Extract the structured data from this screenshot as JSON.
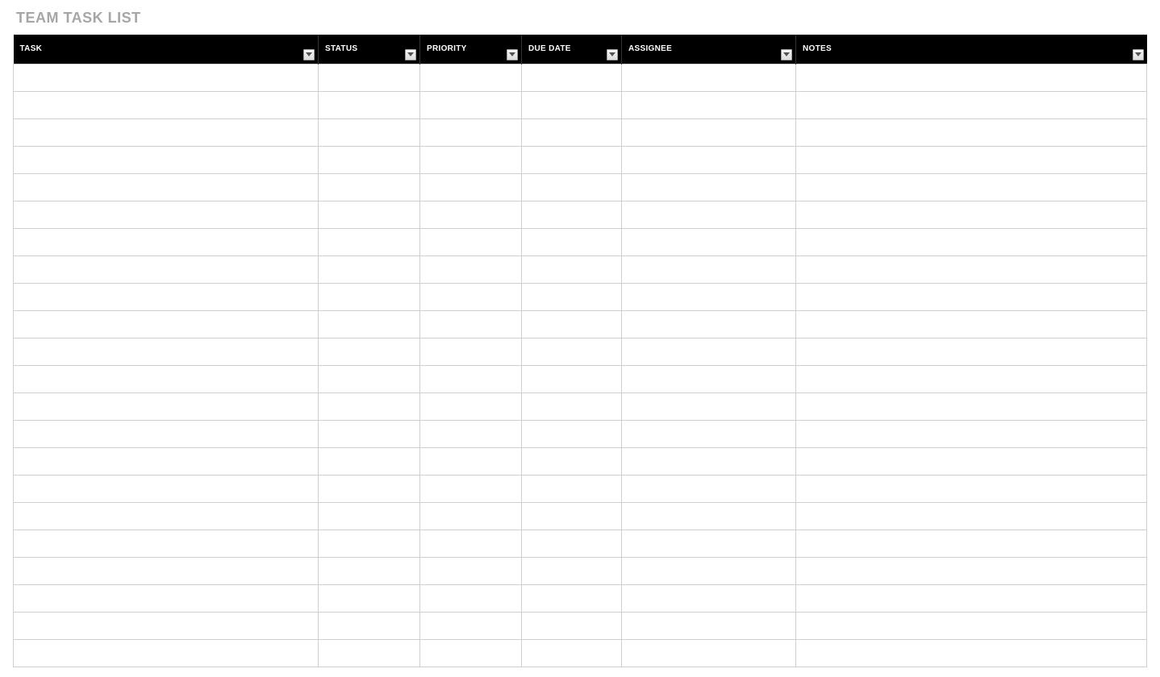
{
  "title": "TEAM TASK LIST",
  "columns": [
    {
      "label": "TASK",
      "key": "task"
    },
    {
      "label": "STATUS",
      "key": "status"
    },
    {
      "label": "PRIORITY",
      "key": "priority"
    },
    {
      "label": "DUE DATE",
      "key": "duedate"
    },
    {
      "label": "ASSIGNEE",
      "key": "assignee"
    },
    {
      "label": "NOTES",
      "key": "notes"
    }
  ],
  "rows": [
    {
      "task": "",
      "status": "",
      "priority": "",
      "duedate": "",
      "assignee": "",
      "notes": ""
    },
    {
      "task": "",
      "status": "",
      "priority": "",
      "duedate": "",
      "assignee": "",
      "notes": ""
    },
    {
      "task": "",
      "status": "",
      "priority": "",
      "duedate": "",
      "assignee": "",
      "notes": ""
    },
    {
      "task": "",
      "status": "",
      "priority": "",
      "duedate": "",
      "assignee": "",
      "notes": ""
    },
    {
      "task": "",
      "status": "",
      "priority": "",
      "duedate": "",
      "assignee": "",
      "notes": ""
    },
    {
      "task": "",
      "status": "",
      "priority": "",
      "duedate": "",
      "assignee": "",
      "notes": ""
    },
    {
      "task": "",
      "status": "",
      "priority": "",
      "duedate": "",
      "assignee": "",
      "notes": ""
    },
    {
      "task": "",
      "status": "",
      "priority": "",
      "duedate": "",
      "assignee": "",
      "notes": ""
    },
    {
      "task": "",
      "status": "",
      "priority": "",
      "duedate": "",
      "assignee": "",
      "notes": ""
    },
    {
      "task": "",
      "status": "",
      "priority": "",
      "duedate": "",
      "assignee": "",
      "notes": ""
    },
    {
      "task": "",
      "status": "",
      "priority": "",
      "duedate": "",
      "assignee": "",
      "notes": ""
    },
    {
      "task": "",
      "status": "",
      "priority": "",
      "duedate": "",
      "assignee": "",
      "notes": ""
    },
    {
      "task": "",
      "status": "",
      "priority": "",
      "duedate": "",
      "assignee": "",
      "notes": ""
    },
    {
      "task": "",
      "status": "",
      "priority": "",
      "duedate": "",
      "assignee": "",
      "notes": ""
    },
    {
      "task": "",
      "status": "",
      "priority": "",
      "duedate": "",
      "assignee": "",
      "notes": ""
    },
    {
      "task": "",
      "status": "",
      "priority": "",
      "duedate": "",
      "assignee": "",
      "notes": ""
    },
    {
      "task": "",
      "status": "",
      "priority": "",
      "duedate": "",
      "assignee": "",
      "notes": ""
    },
    {
      "task": "",
      "status": "",
      "priority": "",
      "duedate": "",
      "assignee": "",
      "notes": ""
    },
    {
      "task": "",
      "status": "",
      "priority": "",
      "duedate": "",
      "assignee": "",
      "notes": ""
    },
    {
      "task": "",
      "status": "",
      "priority": "",
      "duedate": "",
      "assignee": "",
      "notes": ""
    },
    {
      "task": "",
      "status": "",
      "priority": "",
      "duedate": "",
      "assignee": "",
      "notes": ""
    },
    {
      "task": "",
      "status": "",
      "priority": "",
      "duedate": "",
      "assignee": "",
      "notes": ""
    }
  ]
}
